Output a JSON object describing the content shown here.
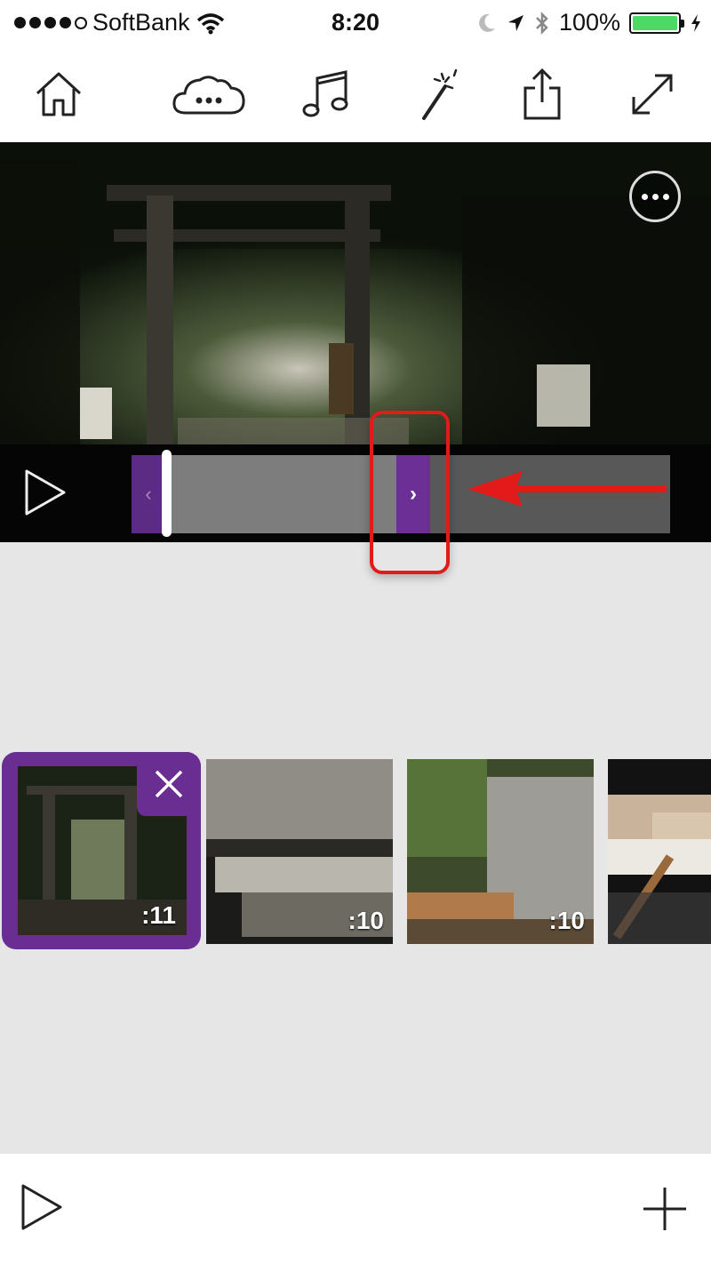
{
  "status_bar": {
    "carrier": "SoftBank",
    "time": "8:20",
    "battery": "100%",
    "signal_bars": 4
  },
  "toolbar": {
    "items": [
      {
        "icon": "home-icon"
      },
      {
        "icon": "cloud-more-icon"
      },
      {
        "icon": "music-icon"
      },
      {
        "icon": "magic-wand-icon"
      },
      {
        "icon": "share-icon"
      },
      {
        "icon": "fullscreen-icon"
      }
    ]
  },
  "player": {
    "more_icon": "more-icon",
    "play_icon": "play-icon",
    "trim_left_glyph": "‹",
    "trim_right_glyph": "›"
  },
  "clips": [
    {
      "duration": ":11",
      "selected": true
    },
    {
      "duration": ":10",
      "selected": false
    },
    {
      "duration": ":10",
      "selected": false
    },
    {
      "duration": "",
      "selected": false
    }
  ],
  "bottom_bar": {
    "play_icon": "play-icon",
    "add_icon": "plus-icon"
  },
  "colors": {
    "accent_purple": "#6a2e93",
    "annotation_red": "#e21a1a",
    "battery_green": "#4cd964"
  }
}
